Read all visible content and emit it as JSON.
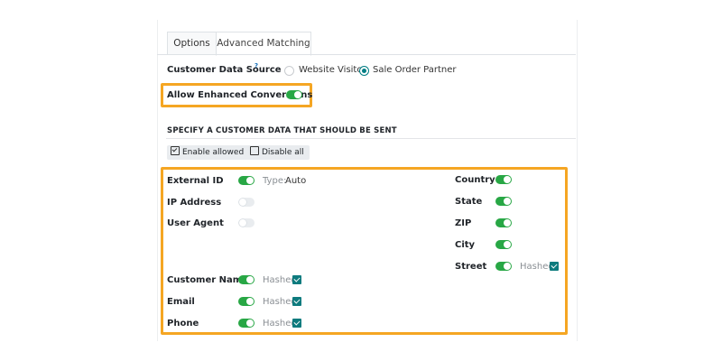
{
  "tabs": [
    {
      "label": "Options"
    },
    {
      "label": "Advanced Matching"
    }
  ],
  "customer_data_source": {
    "label": "Customer Data Source",
    "help": "?",
    "options": [
      {
        "label": "Website Visitor",
        "selected": false
      },
      {
        "label": "Sale Order Partner",
        "selected": true
      }
    ]
  },
  "enhanced_conversions": {
    "label": "Allow Enhanced Conversions",
    "enabled": true
  },
  "section_title": "SPECIFY A CUSTOMER DATA THAT SHOULD BE SENT",
  "buttons": {
    "enable_allowed": "Enable allowed",
    "disable_all": "Disable all"
  },
  "left_fields": [
    {
      "label": "External ID",
      "enabled": true,
      "extra_label": "Type:",
      "extra_value": "Auto"
    },
    {
      "label": "IP Address",
      "enabled": false
    },
    {
      "label": "User Agent",
      "enabled": false
    },
    {
      "label": "Customer Name",
      "enabled": true,
      "hashed_label": "Hashed",
      "hashed": true
    },
    {
      "label": "Email",
      "enabled": true,
      "hashed_label": "Hashed",
      "hashed": true
    },
    {
      "label": "Phone",
      "enabled": true,
      "hashed_label": "Hashed",
      "hashed": true
    }
  ],
  "right_fields": [
    {
      "label": "Country",
      "enabled": true
    },
    {
      "label": "State",
      "enabled": true
    },
    {
      "label": "ZIP",
      "enabled": true
    },
    {
      "label": "City",
      "enabled": true
    },
    {
      "label": "Street",
      "enabled": true,
      "hashed_label": "Hashed",
      "hashed": true
    }
  ],
  "colors": {
    "toggle_on": "#28a745",
    "highlight": "#f5a623",
    "accent": "#017e84",
    "checkbox": "#0e7b7e"
  }
}
